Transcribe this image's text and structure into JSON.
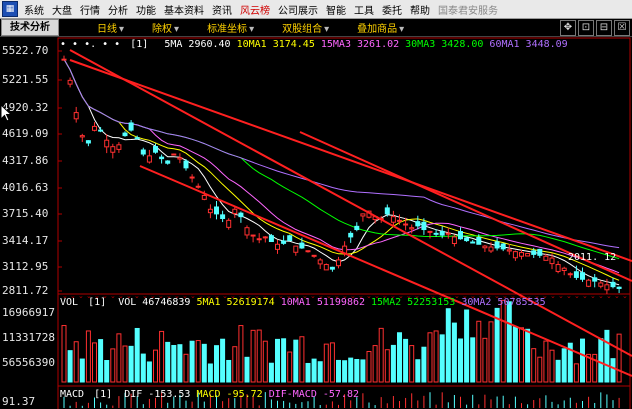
{
  "menu": {
    "items": [
      {
        "label": "系统",
        "style": ""
      },
      {
        "label": "大盘",
        "style": ""
      },
      {
        "label": "行情",
        "style": ""
      },
      {
        "label": "分析",
        "style": ""
      },
      {
        "label": "功能",
        "style": ""
      },
      {
        "label": "基本资料",
        "style": ""
      },
      {
        "label": "资讯",
        "style": ""
      },
      {
        "label": "风云榜",
        "style": "hl"
      },
      {
        "label": "公司展示",
        "style": ""
      },
      {
        "label": "智能",
        "style": ""
      },
      {
        "label": "工具",
        "style": ""
      },
      {
        "label": "委托",
        "style": ""
      },
      {
        "label": "帮助",
        "style": ""
      },
      {
        "label": "国泰君安服务",
        "style": "dim"
      }
    ]
  },
  "toolbar": {
    "title": "技术分析",
    "dropdowns": [
      {
        "label": "日线"
      },
      {
        "label": "除权"
      },
      {
        "label": "标准坐标"
      },
      {
        "label": "双股组合"
      },
      {
        "label": "叠加商品"
      }
    ],
    "window_buttons": [
      "✥",
      "⊡",
      "⊟",
      "☒"
    ]
  },
  "main_panel": {
    "indicator_prefix": "• • •. • •",
    "indicator_mark": "[1]",
    "ma_values": [
      {
        "label": "5MA 2960.40",
        "color": "#ffffff"
      },
      {
        "label": "10MA1 3174.45",
        "color": "#ffff00"
      },
      {
        "label": "15MA3 3261.02",
        "color": "#ff66ff"
      },
      {
        "label": "30MA3 3428.00",
        "color": "#00ff00"
      },
      {
        "label": "60MA1 3448.09",
        "color": "#b070ff"
      }
    ],
    "price_labels": [
      "5522.70",
      "5221.55",
      "4920.32",
      "4619.09",
      "4317.86",
      "4016.63",
      "3715.40",
      "3414.17",
      "3112.95",
      "2811.72"
    ],
    "annotation": "2011. 12"
  },
  "volume_panel": {
    "prefix": "VOL",
    "mark": "[1]",
    "values": [
      {
        "label": "VOL 46746839",
        "color": "#ffffff"
      },
      {
        "label": "5MA1 52619174",
        "color": "#ffff00"
      },
      {
        "label": "10MA1 51199862",
        "color": "#ff66ff"
      },
      {
        "label": "15MA2 52253153",
        "color": "#00ff00"
      },
      {
        "label": "30MA2 50785535",
        "color": "#b070ff"
      }
    ],
    "labels": [
      "16966917",
      "11331728",
      "56556390"
    ]
  },
  "macd_panel": {
    "prefix": "MACD",
    "mark": "[1]",
    "values": [
      {
        "label": "DIF -153.53",
        "color": "#ffffff"
      },
      {
        "label": "MACD -95.72",
        "color": "#ffff00"
      },
      {
        "label": "DIF-MACD -57.82",
        "color": "#ff66ff"
      }
    ],
    "label": "91.37"
  },
  "colors": {
    "up": "#ff3030",
    "down": "#54ffff",
    "channel": "#ff2020",
    "bg": "#000000"
  }
}
